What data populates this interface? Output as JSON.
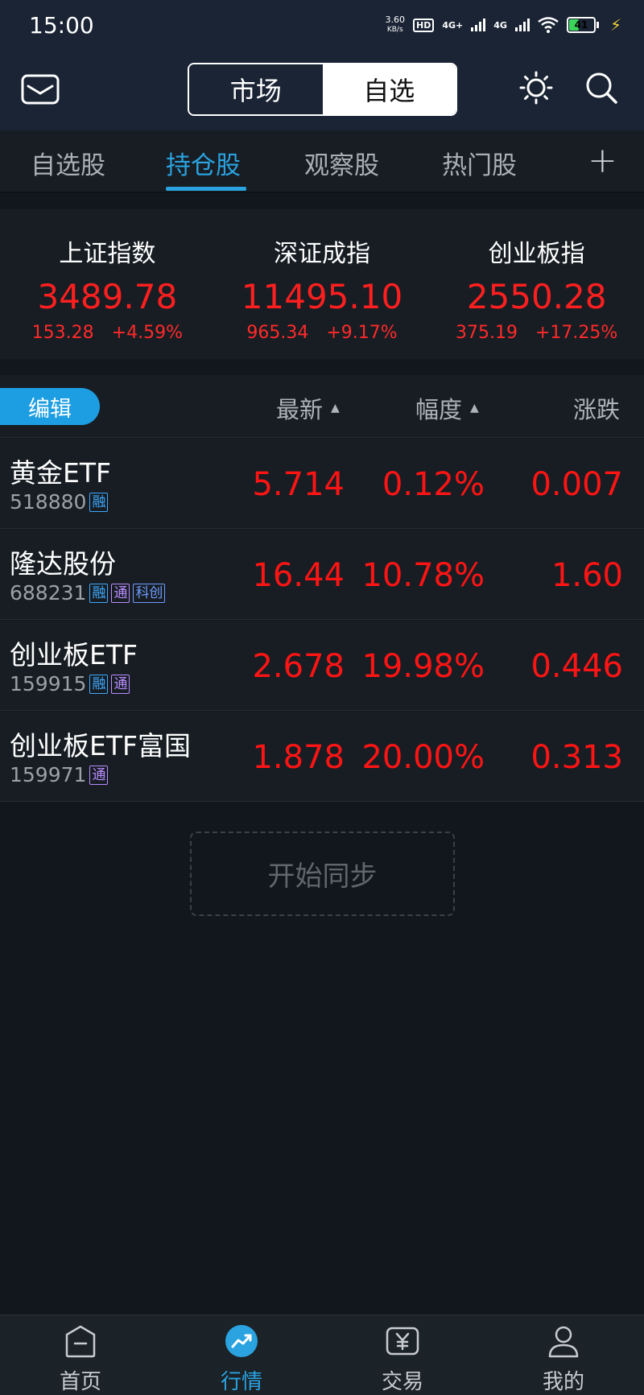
{
  "status_bar": {
    "time": "15:00",
    "net_speed_value": "3.60",
    "net_speed_unit": "KB/s",
    "hd_label": "HD",
    "sim1_tag": "4G+",
    "sim2_tag": "4G",
    "battery_level": "41"
  },
  "header": {
    "segment_market": "市场",
    "segment_watchlist": "自选",
    "active_segment": "自选"
  },
  "tabs": [
    {
      "label": "自选股"
    },
    {
      "label": "持仓股"
    },
    {
      "label": "观察股"
    },
    {
      "label": "热门股"
    }
  ],
  "active_tab": "持仓股",
  "tab_add_label": "+",
  "indices": [
    {
      "name": "上证指数",
      "value": "3489.78",
      "change": "153.28",
      "change_pct": "+4.59%"
    },
    {
      "name": "深证成指",
      "value": "11495.10",
      "change": "965.34",
      "change_pct": "+9.17%"
    },
    {
      "name": "创业板指",
      "value": "2550.28",
      "change": "375.19",
      "change_pct": "+17.25%"
    }
  ],
  "list_header": {
    "edit_label": "编辑",
    "col_latest": "最新",
    "col_pct": "幅度",
    "col_change": "涨跌"
  },
  "stocks": [
    {
      "name": "黄金ETF",
      "code": "518880",
      "tags": [
        "融"
      ],
      "latest": "5.714",
      "pct": "0.12%",
      "change": "0.007"
    },
    {
      "name": "隆达股份",
      "code": "688231",
      "tags": [
        "融",
        "通",
        "科创"
      ],
      "latest": "16.44",
      "pct": "10.78%",
      "change": "1.60"
    },
    {
      "name": "创业板ETF",
      "code": "159915",
      "tags": [
        "融",
        "通"
      ],
      "latest": "2.678",
      "pct": "19.98%",
      "change": "0.446"
    },
    {
      "name": "创业板ETF富国",
      "code": "159971",
      "tags": [
        "通"
      ],
      "latest": "1.878",
      "pct": "20.00%",
      "change": "0.313"
    }
  ],
  "sync_button_label": "开始同步",
  "bottom_nav": [
    {
      "label": "首页",
      "icon": "home-icon"
    },
    {
      "label": "行情",
      "icon": "market-trend-icon"
    },
    {
      "label": "交易",
      "icon": "trade-yuan-icon"
    },
    {
      "label": "我的",
      "icon": "profile-icon"
    }
  ],
  "active_nav": "行情",
  "colors": {
    "accent": "#2aa3e0",
    "up_red": "#ff1414",
    "header_bg": "#1a2434",
    "page_bg": "#11171c"
  }
}
